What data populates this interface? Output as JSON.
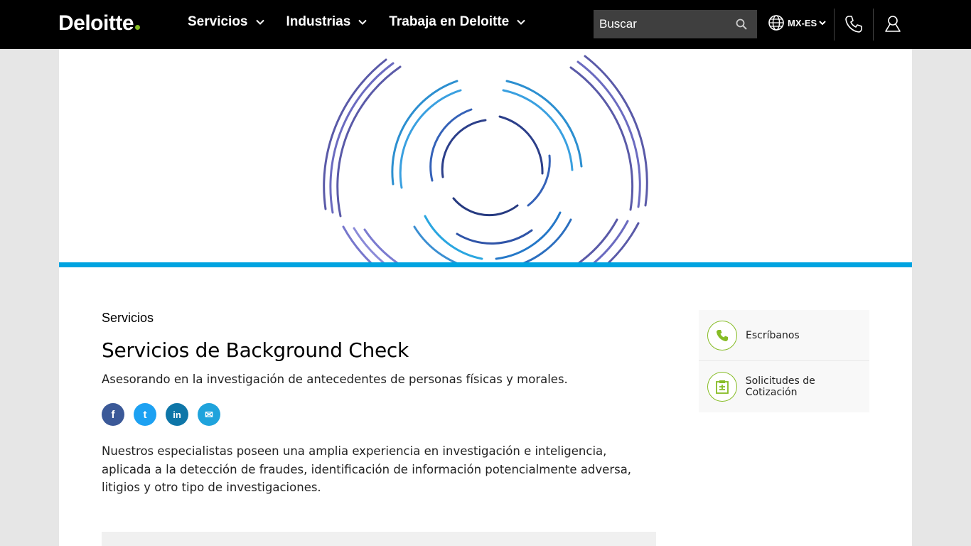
{
  "header": {
    "logo_text": "Deloitte",
    "nav": [
      {
        "label": "Servicios"
      },
      {
        "label": "Industrias"
      },
      {
        "label": "Trabaja en Deloitte"
      }
    ],
    "search": {
      "placeholder": "Buscar"
    },
    "locale": "MX-ES"
  },
  "content": {
    "eyebrow": "Servicios",
    "title": "Servicios de Background Check",
    "subtitle": "Asesorando en la investigación de antecedentes de personas físicas y morales.",
    "share": [
      {
        "label": "f",
        "color": "#3b5998"
      },
      {
        "label": "t",
        "color": "#1da1f2"
      },
      {
        "label": "in",
        "color": "#0e76a8"
      },
      {
        "label": "✉",
        "color": "#1fa3dc"
      }
    ],
    "body": "Nuestros especialistas poseen una amplia experiencia en investigación e inteligencia, aplicada a la detección de fraudes, identificación de información potencialmente adversa, litigios y otro tipo de investigaciones."
  },
  "side_panel": {
    "items": [
      {
        "label": "Escríbanos",
        "icon": "phone-icon"
      },
      {
        "label": "Solicitudes de Cotización",
        "icon": "clipboard-icon"
      }
    ]
  },
  "colors": {
    "brand_green": "#86bc25",
    "accent_blue": "#00a3e0",
    "header_bg": "#000000"
  }
}
